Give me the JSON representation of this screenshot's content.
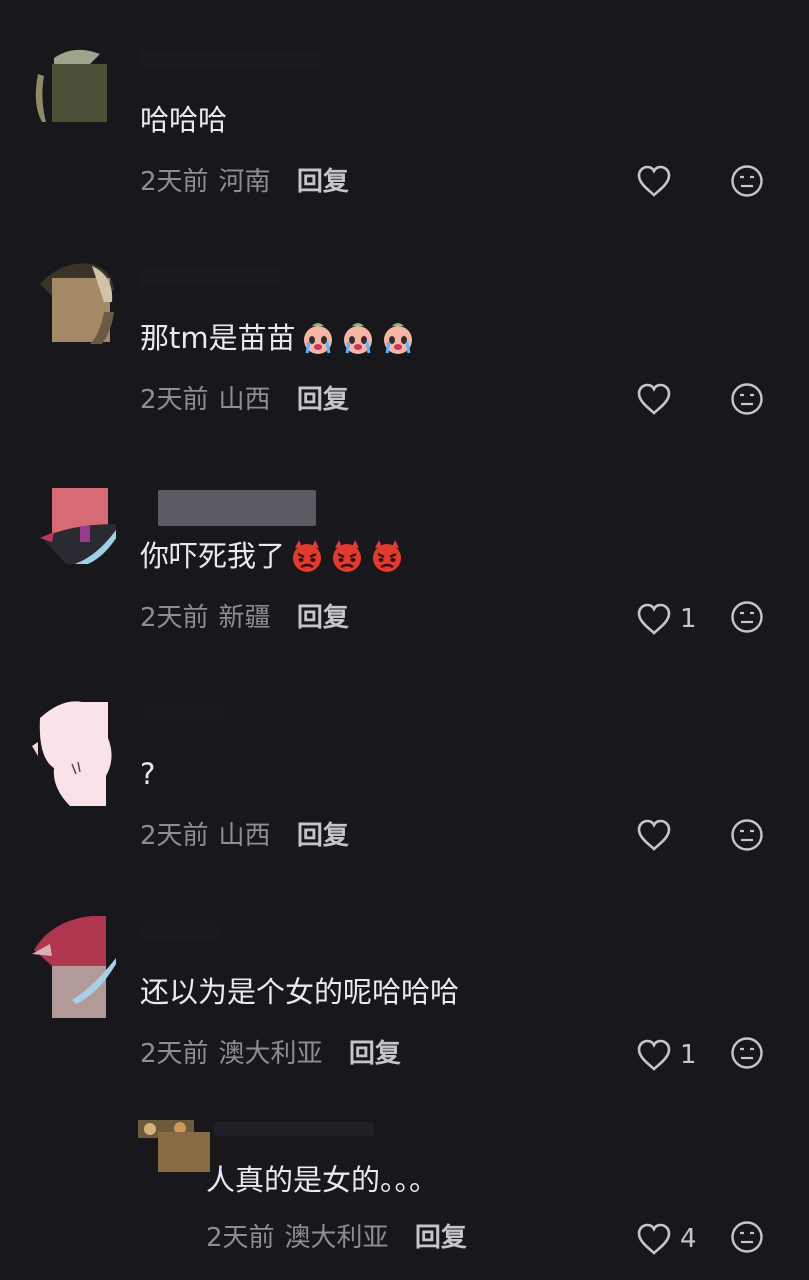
{
  "comments": [
    {
      "text": "哈哈哈",
      "time": "2天前",
      "location": "河南",
      "reply_label": "回复",
      "likes": "",
      "emoji": [],
      "avatar_colors": [
        "#4a5036",
        "#7f7a55"
      ]
    },
    {
      "text": "那tm是苗苗",
      "time": "2天前",
      "location": "山西",
      "reply_label": "回复",
      "likes": "",
      "emoji": [
        "crying-face-icon",
        "crying-face-icon",
        "crying-face-icon"
      ],
      "avatar_colors": [
        "#a38a67",
        "#c9b08c"
      ]
    },
    {
      "text": "你吓死我了",
      "time": "2天前",
      "location": "新疆",
      "reply_label": "回复",
      "likes": "1",
      "emoji": [
        "angry-devil-icon",
        "angry-devil-icon",
        "angry-devil-icon"
      ],
      "avatar_colors": [
        "#d66b76",
        "#9a3a8a"
      ]
    },
    {
      "text": "?",
      "time": "2天前",
      "location": "山西",
      "reply_label": "回复",
      "likes": "",
      "emoji": [],
      "avatar_colors": [
        "#f9e3e8",
        "#f5d6dc"
      ]
    },
    {
      "text": "还以为是个女的呢哈哈哈",
      "time": "2天前",
      "location": "澳大利亚",
      "reply_label": "回复",
      "likes": "1",
      "emoji": [],
      "avatar_colors": [
        "#b0364f",
        "#b29a98"
      ]
    }
  ],
  "reply": {
    "text": "人真的是女的。。。",
    "time": "2天前",
    "location": "澳大利亚",
    "reply_label": "回复",
    "likes": "4",
    "avatar_colors": [
      "#8a6a44",
      "#c9a57a"
    ]
  },
  "theme": {
    "background": "#17171c",
    "text": "#e9e9ee",
    "meta": "#8d8d96"
  }
}
